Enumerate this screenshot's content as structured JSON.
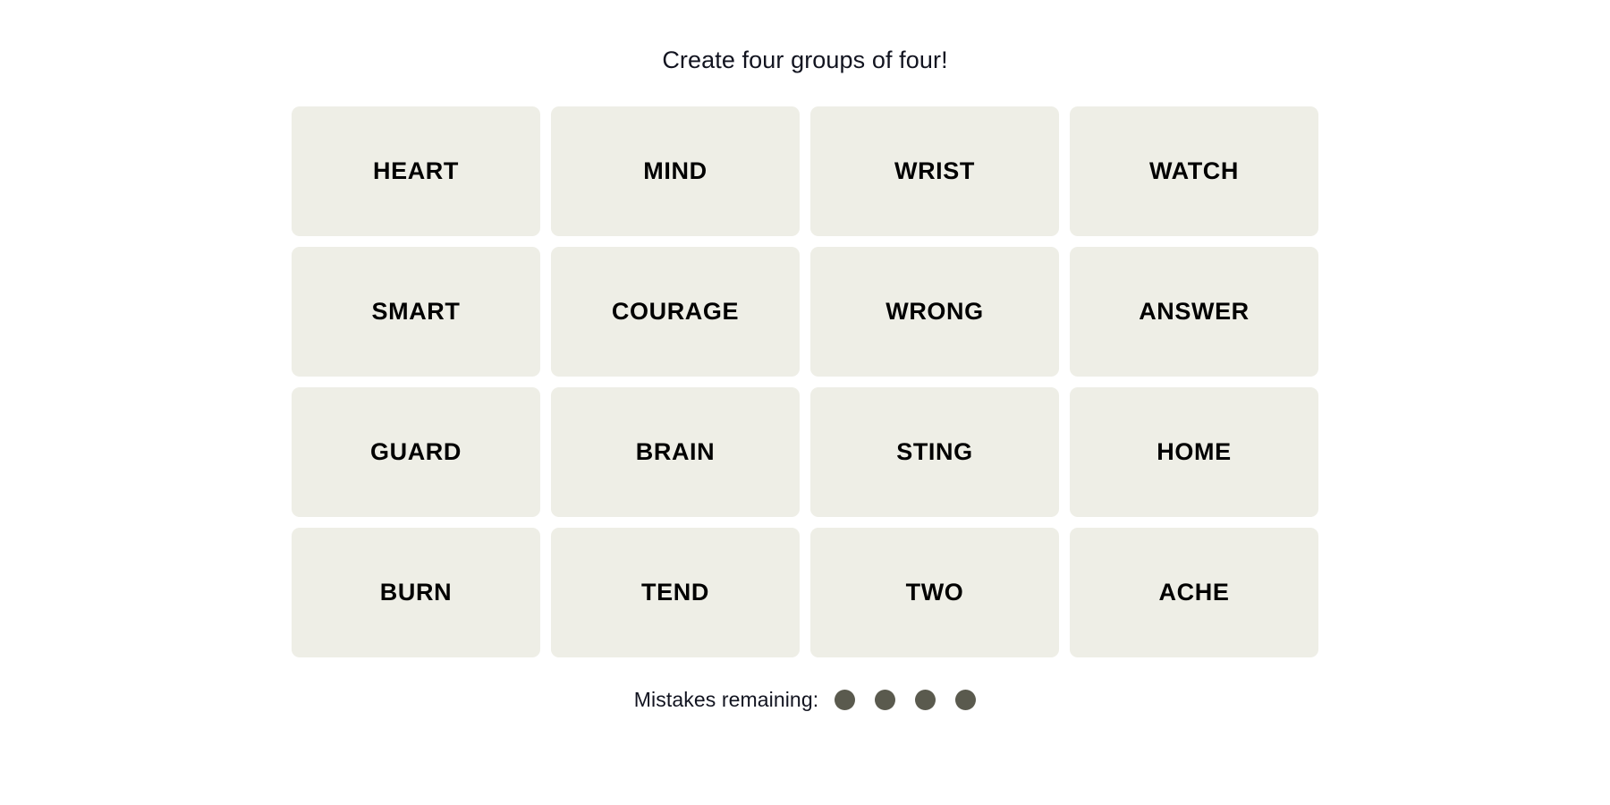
{
  "page": {
    "background_color": "#ffffff"
  },
  "header": {
    "title": "Create four groups of four!"
  },
  "board": {
    "tile_background": "#eeeee6",
    "tile_text_color": "#000000",
    "rows": [
      {
        "tiles": [
          {
            "word": "HEART"
          },
          {
            "word": "MIND"
          },
          {
            "word": "WRIST"
          },
          {
            "word": "WATCH"
          }
        ]
      },
      {
        "tiles": [
          {
            "word": "SMART"
          },
          {
            "word": "COURAGE"
          },
          {
            "word": "WRONG"
          },
          {
            "word": "ANSWER"
          }
        ]
      },
      {
        "tiles": [
          {
            "word": "GUARD"
          },
          {
            "word": "BRAIN"
          },
          {
            "word": "STING"
          },
          {
            "word": "HOME"
          }
        ]
      },
      {
        "tiles": [
          {
            "word": "BURN"
          },
          {
            "word": "TEND"
          },
          {
            "word": "TWO"
          },
          {
            "word": "ACHE"
          }
        ]
      }
    ]
  },
  "footer": {
    "mistakes_label": "Mistakes remaining:",
    "mistakes_count": 4,
    "dot_color": "#5a5a4e",
    "dots": [
      {
        "icon": "mistake-dot-icon"
      },
      {
        "icon": "mistake-dot-icon"
      },
      {
        "icon": "mistake-dot-icon"
      },
      {
        "icon": "mistake-dot-icon"
      }
    ]
  }
}
